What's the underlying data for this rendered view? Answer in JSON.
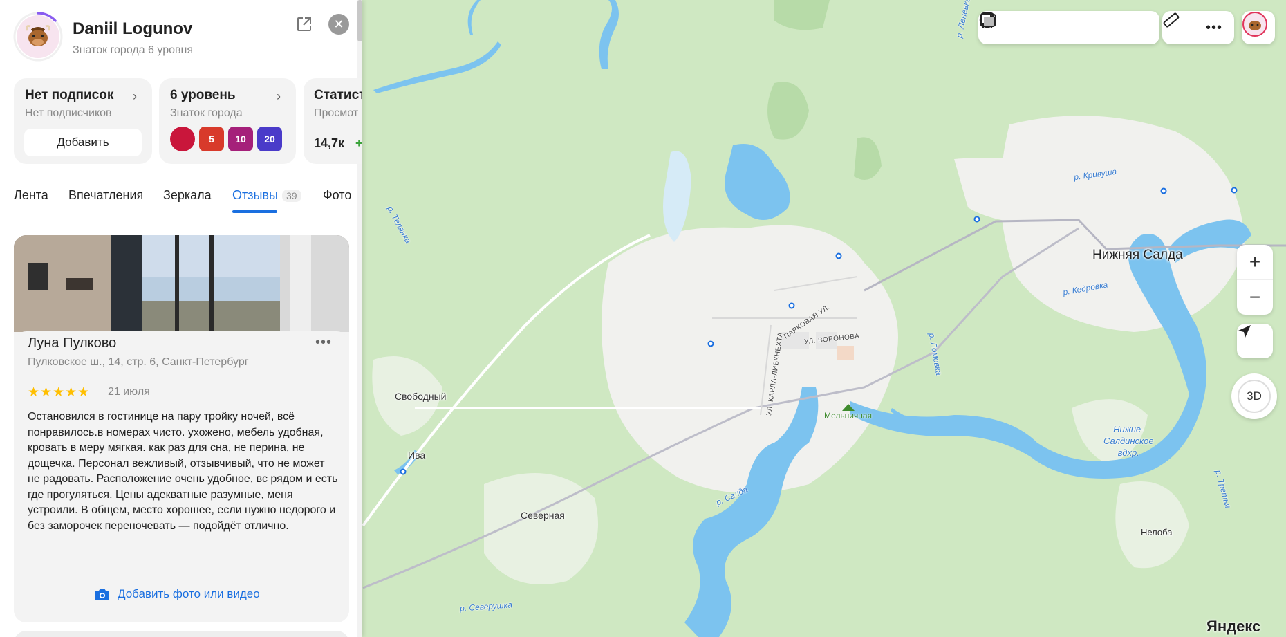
{
  "profile": {
    "name": "Daniil Logunov",
    "subtitle": "Знаток города 6 уровня"
  },
  "cards": {
    "subscriptions": {
      "title": "Нет подписок",
      "subtitle": "Нет подписчиков",
      "button": "Добавить"
    },
    "level": {
      "title": "6 уровень",
      "subtitle": "Знаток города",
      "badges": [
        "",
        "5",
        "10",
        "20"
      ]
    },
    "stats": {
      "title": "Статист",
      "subtitle": "Просмот",
      "value": "14,7к",
      "delta": "+"
    }
  },
  "tabs": [
    {
      "label": "Лента"
    },
    {
      "label": "Впечатления"
    },
    {
      "label": "Зеркала"
    },
    {
      "label": "Отзывы",
      "count": "39",
      "active": true
    },
    {
      "label": "Фото"
    }
  ],
  "review": {
    "title": "Луна Пулково",
    "address": "Пулковское ш., 14, стр. 6, Санкт-Петербург",
    "stars": "★★★★★",
    "rating": 5,
    "date": "21 июля",
    "text": "Остановился в гостинице на пару тройку ночей, всё понравилось.в номерах чисто. ухожено, мебель удобная, кровать в меру мягкая. как раз для сна, не перина, не дощечка. Персонал вежливый, отзывчивый, что не может не радовать. Расположение очень удобное, вс рядом и есть где прогуляться. Цены адекватные разумные, меня устроили. В общем, место хорошее, если нужно недорого и без заморочек переночевать — подойдёт отлично.",
    "add_media": "Добавить фото или видео",
    "more": "•••"
  },
  "map": {
    "places": {
      "nizhnyaya_salda": "Нижняя Салда",
      "svobodny": "Свободный",
      "iva": "Ива",
      "severnaya": "Северная",
      "neloba": "Нелоба",
      "reservoir": "Нижне-\nСалдинское\nвдхр."
    },
    "rivers": {
      "krivusha": "р. Кривуша",
      "kedrovka": "р. Кедровка",
      "telyana": "р. Телянка",
      "lomovka": "р. Ломовка",
      "salda": "р. Салда",
      "severushka": "р. Северушка",
      "tretya": "р. Третья",
      "lenevka": "р. Леневка"
    },
    "streets": {
      "parkovaya": "ПАРКОВАЯ УЛ.",
      "voronova": "УЛ. ВОРОНОВА",
      "karla": "УЛ. КАРЛА-ЛИБКНЕХТА"
    },
    "poi": {
      "melnichnaya": "Мельничная"
    },
    "zoom_in": "+",
    "zoom_out": "−",
    "btn_3d": "3D",
    "brand": "Яндекс"
  },
  "colors": {
    "accent": "#1a6fe0",
    "forest": "#cfe8c2",
    "water": "#7cc3ef",
    "town": "#f2f2f2",
    "star": "#ffbf00"
  }
}
